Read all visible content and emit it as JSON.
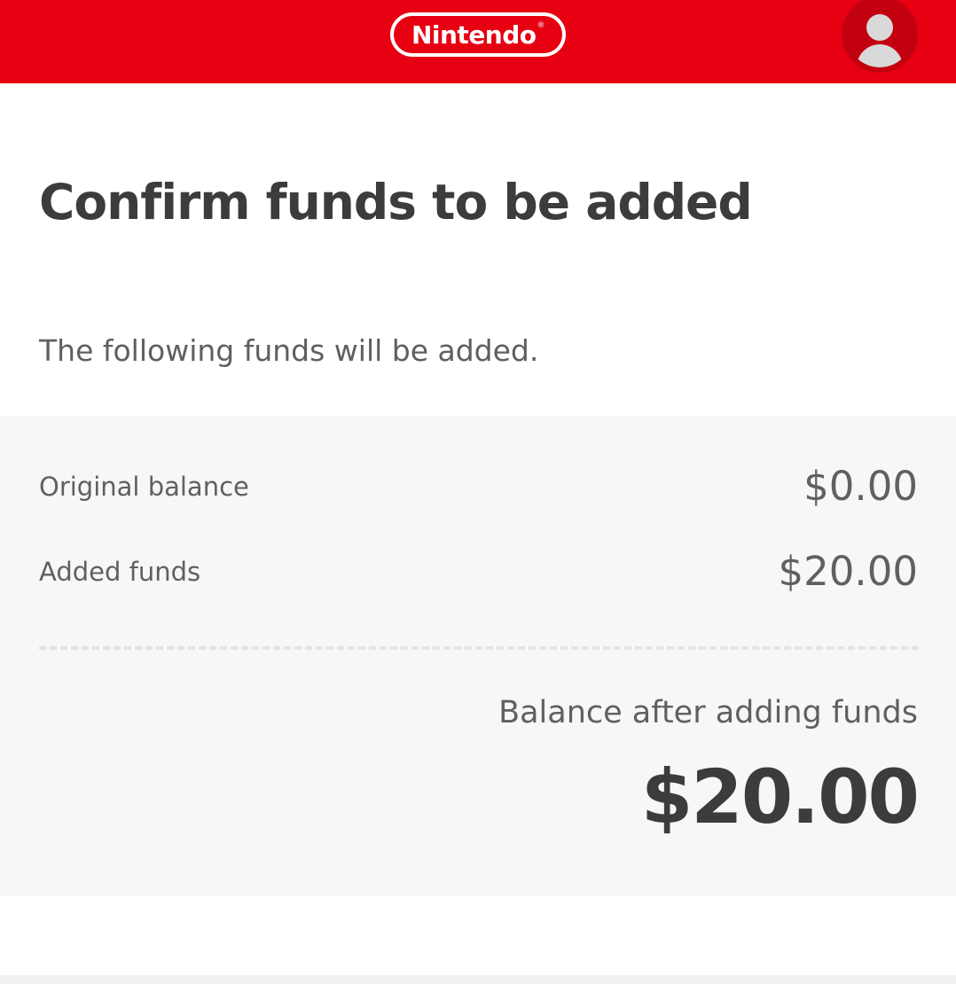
{
  "header": {
    "logo_text": "Nintendo",
    "logo_reg_mark": "®",
    "brand_color": "#e60012",
    "avatar_icon": "user-avatar-icon"
  },
  "main": {
    "title": "Confirm funds to be added",
    "intro": "The following funds will be added."
  },
  "summary": {
    "rows": [
      {
        "label": "Original balance",
        "value": "$0.00"
      },
      {
        "label": "Added funds",
        "value": "$20.00"
      }
    ],
    "after_label": "Balance after adding funds",
    "after_value": "$20.00"
  }
}
